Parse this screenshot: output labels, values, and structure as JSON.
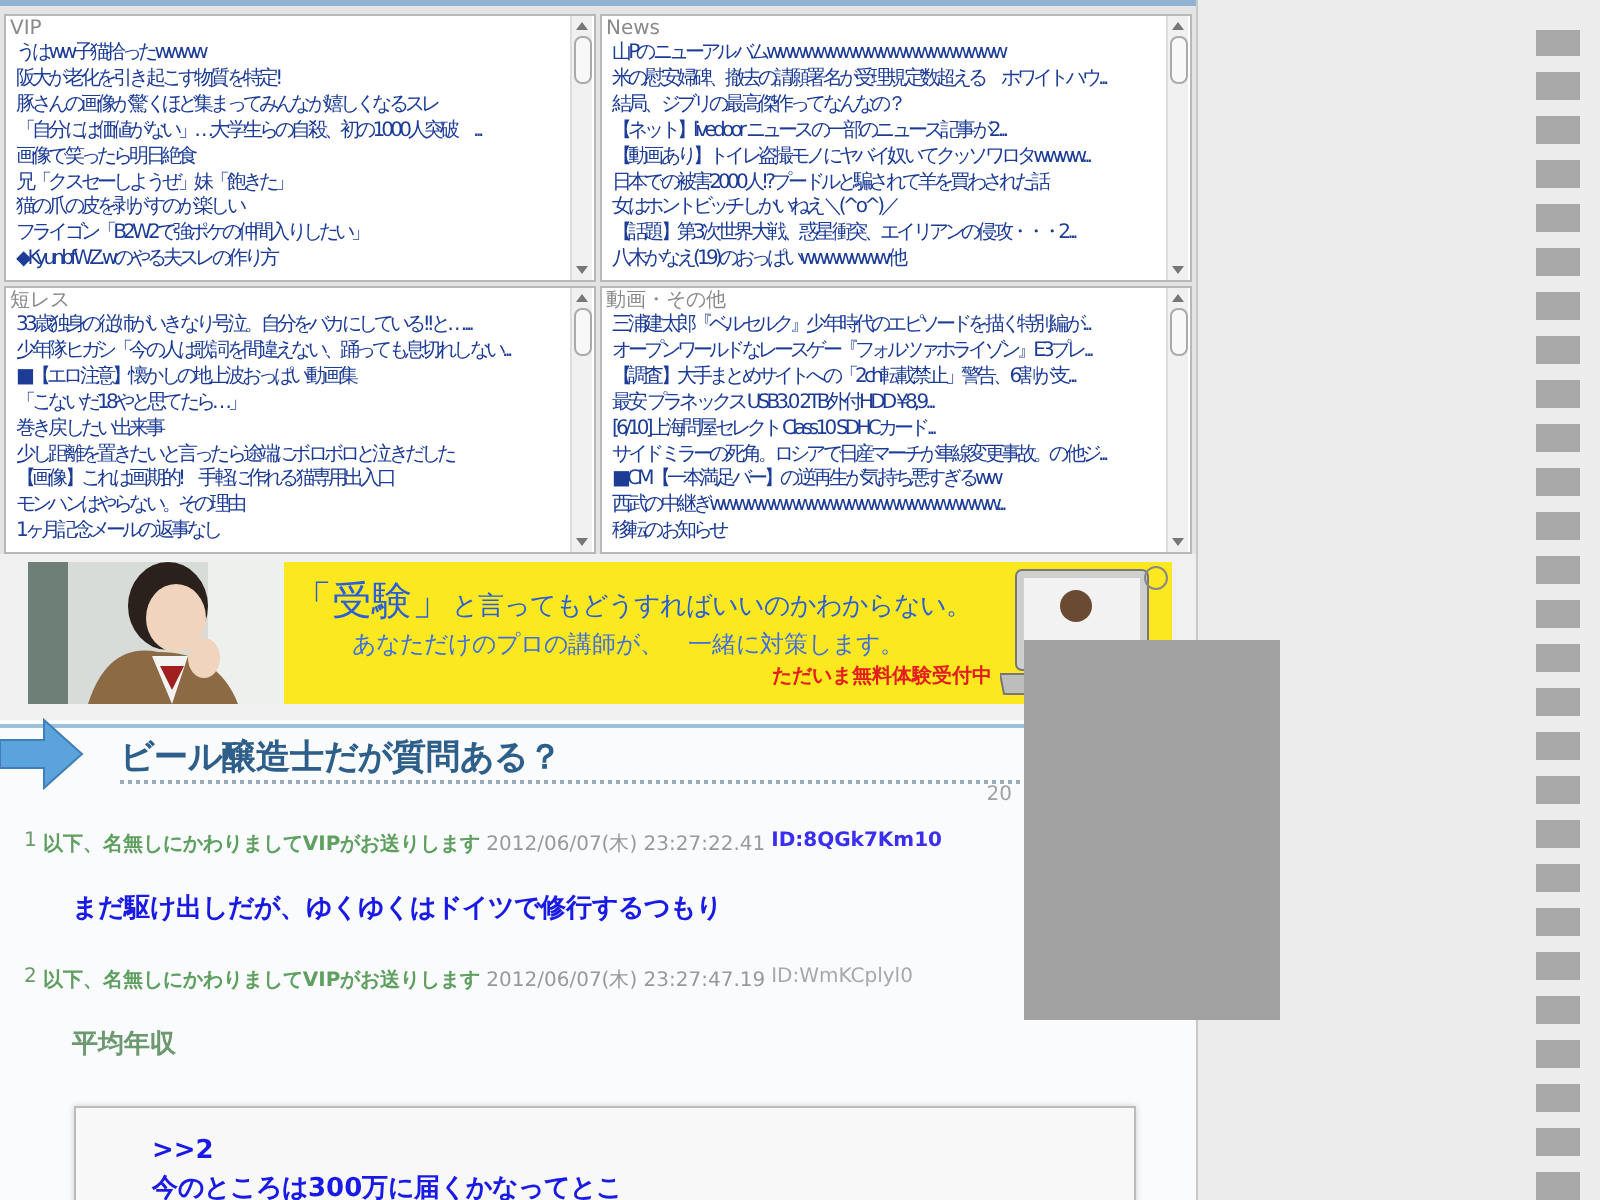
{
  "panels": [
    {
      "title": "VIP",
      "items": [
        "うはww子猫拾ったwwww",
        "阪大が老化を引き起こす物質を特定!",
        "豚さんの画像が驚くほど集まってみんなが嬉しくなるスレ",
        "「自分には価値がない」…大学生らの自殺、初の1000人突破　...",
        "画像で笑ったら明日絶食",
        "兄「クスセーしようぜ」妹「飽きた」",
        "猫の爪の皮を剥がすのが楽しい",
        "フライゴン「B2W2で強ポケの仲間入りしたい」",
        "◆KyunbfWZ.wのやる夫スレの作り方"
      ]
    },
    {
      "title": "News",
      "items": [
        "山Pのニューアルバムwwwwwwwwwwwwwwwwwww",
        "米の慰安婦碑、撤去の請願署名が受理規定数超える　ホワイトハウ...",
        "結局、ジブリの最高傑作ってなんなの？",
        "【ネット】livedoor ニュースの一部のニュース記事が2...",
        "【動画あり】トイレ盗撮モノにヤバイ奴いてクッソワロタwwww...",
        "日本での被害2000人!?プードルと騙されて羊を買わされた話",
        "女はホントビッチしかいねえ＼(^o^)／",
        "【話題】第3次世界大戦、惑星衝突、エイリアンの侵攻・・・2...",
        "八木かなえ(19)のおっぱいwwwwwww他"
      ]
    },
    {
      "title": "短レス",
      "items": [
        "33歳独身の従姉がいきなり号泣。自分をバカにしている!!と…...",
        "少年隊ヒガシ「今の人は歌詞を間違えない、踊っても息切れしない...",
        "■【エロ注意】懐かしの地上波おっぱい動画集",
        "「こないだ18やと思てたら…」",
        "巻き戻したい出来事",
        "少し距離を置きたいと言ったら途端にボロボロと泣きだした",
        "【画像】これは画期的!　手軽に作れる猫専用出入口",
        "モンハンはやらない。その理由",
        "1ヶ月記念メールの返事なし"
      ]
    },
    {
      "title": "動画・その他",
      "items": [
        "三浦建太郎『ベルセルク』少年時代のエピソードを描く特別編が...",
        "オープンワールドなレースゲー『フォルツァホライゾン』E3プレ...",
        "【調査】大手まとめサイトへの「2ch転載禁止」警告、6割が支...",
        "最安 プラネックス USB3.0 2TB外付HDD ¥8,9...",
        "[6/10]上海問屋セレクト Class10 SDHCカード...",
        "サイドミラーの死角。ロシアで日産マーチが車線変更事故。の他ジ...",
        "■CM【一本満足バー】の逆再生が気持ち悪すぎるww",
        "西武の中継ぎwwwwwwwwwwwwwwwwwwwwwww...",
        "移転のお知らせ"
      ]
    }
  ],
  "ad": {
    "headline_quote": "「受験」",
    "headline_rest": "と言ってもどうすればいいのかわからない。",
    "subline": "あなただけのプロの講師が、　一緒に対策します。",
    "cta": "ただいま無料体験受付中"
  },
  "article": {
    "title": "ビール醸造士だが質問ある？",
    "date": "20"
  },
  "posts": [
    {
      "number": "1",
      "name": "以下、名無しにかわりましてVIPがお送りします",
      "date": "2012/06/07(木) 23:27:22.41",
      "id": "ID:8QGk7Km10",
      "id_highlighted": true,
      "body": [
        "まだ駆け出しだが、ゆくゆくはドイツで修行するつもり"
      ],
      "color": "#1a1ae6",
      "kind": "post"
    },
    {
      "number": "2",
      "name": "以下、名無しにかわりましてVIPがお送りします",
      "date": "2012/06/07(木) 23:27:47.19",
      "id": "ID:WmKCplyl0",
      "id_highlighted": false,
      "body": [
        "平均年収"
      ],
      "color": "#6d9970",
      "kind": "post"
    },
    {
      "body": [
        ">>2",
        "今のところは300万に届くかなってとこ"
      ],
      "color": "#1a1ae6",
      "kind": "quote"
    }
  ]
}
